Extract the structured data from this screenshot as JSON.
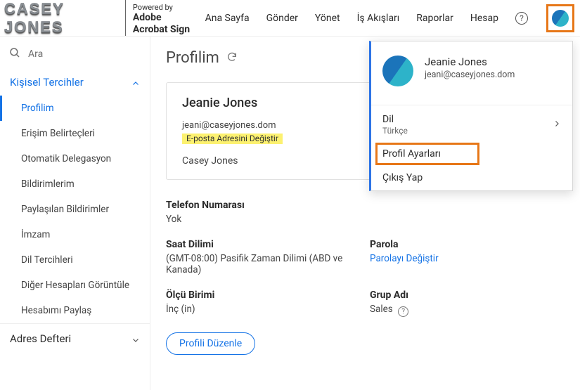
{
  "brand": {
    "name": "CASEY JONES",
    "powered_label": "Powered by",
    "powered_brand1": "Adobe",
    "powered_brand2": "Acrobat Sign"
  },
  "nav": {
    "home": "Ana Sayfa",
    "send": "Gönder",
    "manage": "Yönet",
    "workflows": "İş Akışları",
    "reports": "Raporlar",
    "account": "Hesap"
  },
  "search": {
    "placeholder": "Ara"
  },
  "sidebar": {
    "section1": "Kişisel Tercihler",
    "section2": "Adres Defteri",
    "items": [
      "Profilim",
      "Erişim Belirteçleri",
      "Otomatik Delegasyon",
      "Bildirimlerim",
      "Paylaşılan Bildirimler",
      "İmzam",
      "Dil Tercihleri",
      "Diğer Hesapları Görüntüle",
      "Hesabımı Paylaş"
    ]
  },
  "page": {
    "title": "Profilim"
  },
  "profile": {
    "name": "Jeanie Jones",
    "email": "jeani@caseyjones.dom",
    "change_email": "E-posta Adresini Değiştir",
    "company": "Casey Jones",
    "phone_label": "Telefon Numarası",
    "phone_value": "Yok",
    "tz_label": "Saat Dilimi",
    "tz_value": "(GMT-08:00) Pasifik Zaman Dilimi (ABD ve Kanada)",
    "pw_label": "Parola",
    "pw_link": "Parolayı Değiştir",
    "unit_label": "Ölçü Birimi",
    "unit_value": "İnç (in)",
    "group_label": "Grup Adı",
    "group_value": "Sales",
    "edit_btn": "Profili Düzenle"
  },
  "popover": {
    "name": "Jeanie Jones",
    "email": "jeani@caseyjones.dom",
    "lang_label": "Dil",
    "lang_value": "Türkçe",
    "settings": "Profil Ayarları",
    "signout": "Çıkış Yap"
  }
}
